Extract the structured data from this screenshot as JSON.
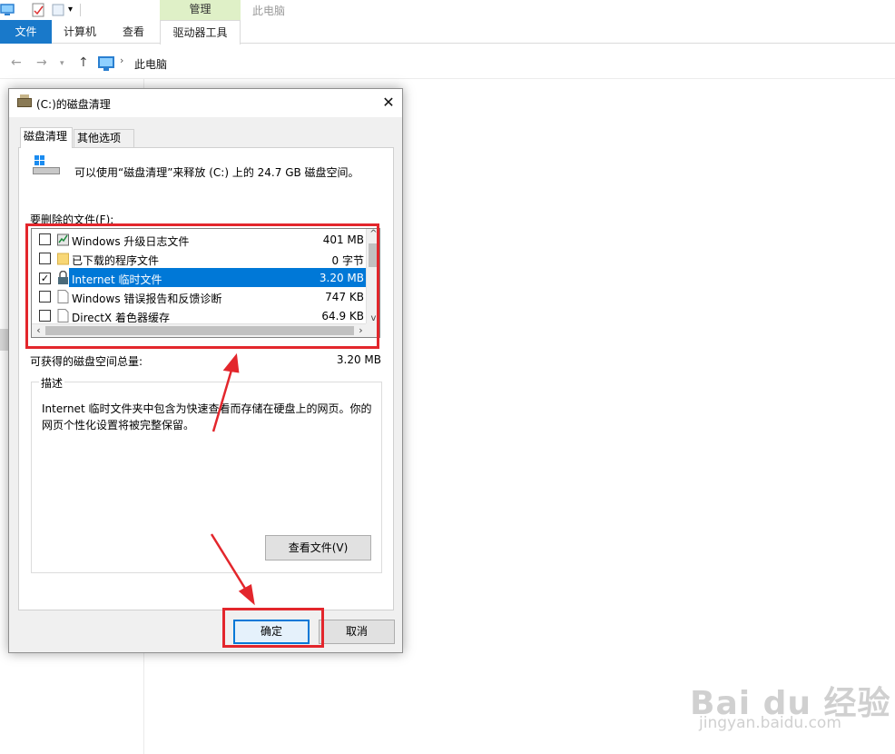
{
  "explorer": {
    "ribbon_tabs": {
      "file": "文件",
      "computer": "计算机",
      "view": "查看",
      "drive_tools": "驱动器工具"
    },
    "context_tab": "管理",
    "window_title": "此电脑",
    "address": "此电脑"
  },
  "dialog": {
    "title": "(C:)的磁盘清理",
    "tabs": [
      "磁盘清理",
      "其他选项"
    ],
    "intro": "可以使用“磁盘清理”来释放  (C:) 上的 24.7 GB 磁盘空间。",
    "files_label": "要删除的文件(F):",
    "files": [
      {
        "name": "Windows 升级日志文件",
        "size": "401 MB",
        "checked": false,
        "icon": "log-file-icon"
      },
      {
        "name": "已下载的程序文件",
        "size": "0 字节",
        "checked": false,
        "icon": "folder-icon"
      },
      {
        "name": "Internet 临时文件",
        "size": "3.20 MB",
        "checked": true,
        "selected": true,
        "icon": "lock-icon"
      },
      {
        "name": "Windows 错误报告和反馈诊断",
        "size": "747 KB",
        "checked": false,
        "icon": "document-icon"
      },
      {
        "name": "DirectX 着色器缓存",
        "size": "64.9 KB",
        "checked": false,
        "icon": "document-icon"
      }
    ],
    "total_label": "可获得的磁盘空间总量:",
    "total_value": "3.20 MB",
    "description_legend": "描述",
    "description": "Internet 临时文件夹中包含为快速查看而存储在硬盘上的网页。你的网页个性化设置将被完整保留。",
    "view_files_button": "查看文件(V)",
    "ok_button": "确定",
    "cancel_button": "取消"
  },
  "watermark": {
    "main": "Bai du 经验",
    "sub": "jingyan.baidu.com"
  },
  "colors": {
    "accent": "#0078d7",
    "ribbon_file": "#1979ca",
    "annotation": "#e3262c",
    "context_tab": "#dff0c7"
  }
}
